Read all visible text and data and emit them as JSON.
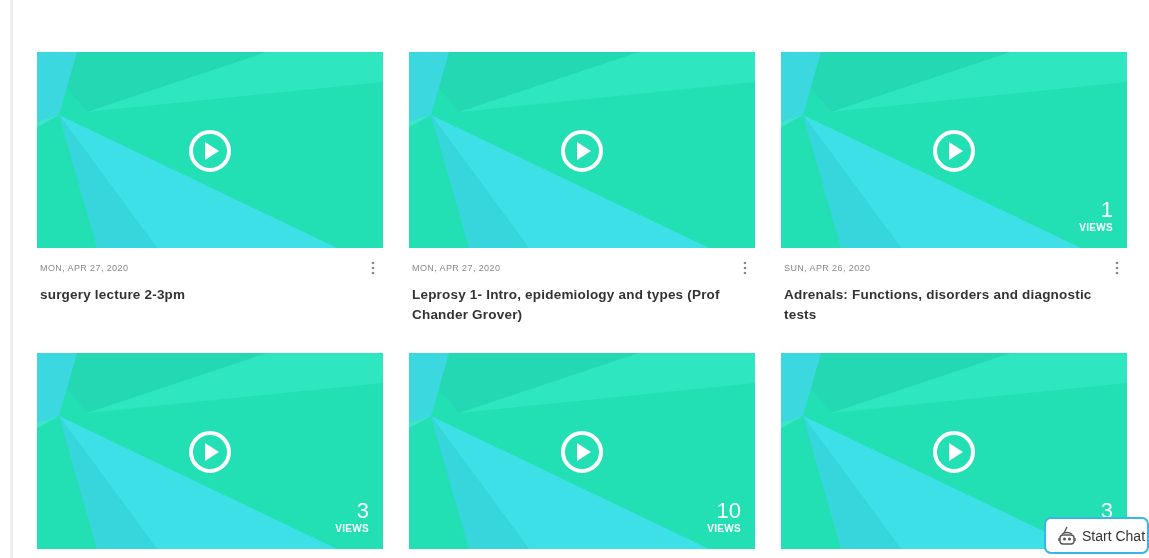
{
  "videos": [
    {
      "date": "MON, APR 27, 2020",
      "title": "surgery lecture 2-3pm"
    },
    {
      "date": "MON, APR 27, 2020",
      "title": "Leprosy 1- Intro, epidemiology and types (Prof Chander Grover)"
    },
    {
      "date": "SUN, APR 26, 2020",
      "title": "Adrenals: Functions, disorders and diagnostic tests",
      "views": "1",
      "views_label": "VIEWS"
    },
    {
      "views": "3",
      "views_label": "VIEWS"
    },
    {
      "views": "10",
      "views_label": "VIEWS"
    },
    {
      "views": "3"
    }
  ],
  "chat_button": {
    "label": "Start Chat"
  }
}
